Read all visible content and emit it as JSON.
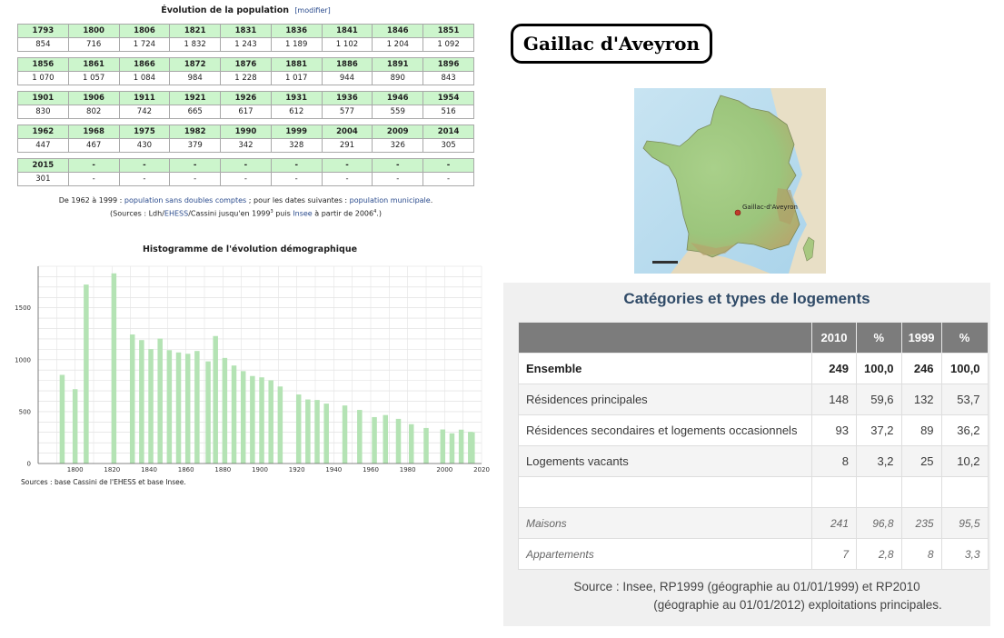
{
  "population": {
    "title": "Évolution de la population",
    "edit_link": "[modifier]",
    "rows": [
      {
        "years": [
          "1793",
          "1800",
          "1806",
          "1821",
          "1831",
          "1836",
          "1841",
          "1846",
          "1851"
        ],
        "values": [
          "854",
          "716",
          "1 724",
          "1 832",
          "1 243",
          "1 189",
          "1 102",
          "1 204",
          "1 092"
        ]
      },
      {
        "years": [
          "1856",
          "1861",
          "1866",
          "1872",
          "1876",
          "1881",
          "1886",
          "1891",
          "1896"
        ],
        "values": [
          "1 070",
          "1 057",
          "1 084",
          "984",
          "1 228",
          "1 017",
          "944",
          "890",
          "843"
        ]
      },
      {
        "years": [
          "1901",
          "1906",
          "1911",
          "1921",
          "1926",
          "1931",
          "1936",
          "1946",
          "1954"
        ],
        "values": [
          "830",
          "802",
          "742",
          "665",
          "617",
          "612",
          "577",
          "559",
          "516"
        ]
      },
      {
        "years": [
          "1962",
          "1968",
          "1975",
          "1982",
          "1990",
          "1999",
          "2004",
          "2009",
          "2014"
        ],
        "values": [
          "447",
          "467",
          "430",
          "379",
          "342",
          "328",
          "291",
          "326",
          "305"
        ]
      },
      {
        "years": [
          "2015",
          "-",
          "-",
          "-",
          "-",
          "-",
          "-",
          "-",
          "-"
        ],
        "values": [
          "301",
          "-",
          "-",
          "-",
          "-",
          "-",
          "-",
          "-",
          "-"
        ]
      }
    ],
    "note": {
      "p1": "De 1962 à 1999 : ",
      "l1": "population sans doubles comptes",
      "p2": " ; pour les dates suivantes : ",
      "l2": "population municipale",
      "p3": ".",
      "p4": "(Sources : Ldh/",
      "l3": "EHESS",
      "p5": "/Cassini jusqu'en 1999",
      "sup1": "3",
      "p6": " puis ",
      "l4": "Insee",
      "p7": " à partir de 2006",
      "sup2": "4",
      "p8": ".)"
    }
  },
  "chart_data": {
    "type": "bar",
    "title": "Histogramme de l'évolution démographique",
    "x": [
      1793,
      1800,
      1806,
      1821,
      1831,
      1836,
      1841,
      1846,
      1851,
      1856,
      1861,
      1866,
      1872,
      1876,
      1881,
      1886,
      1891,
      1896,
      1901,
      1906,
      1911,
      1921,
      1926,
      1931,
      1936,
      1946,
      1954,
      1962,
      1968,
      1975,
      1982,
      1990,
      1999,
      2004,
      2009,
      2014,
      2015
    ],
    "values": [
      854,
      716,
      1724,
      1832,
      1243,
      1189,
      1102,
      1204,
      1092,
      1070,
      1057,
      1084,
      984,
      1228,
      1017,
      944,
      890,
      843,
      830,
      802,
      742,
      665,
      617,
      612,
      577,
      559,
      516,
      447,
      467,
      430,
      379,
      342,
      328,
      291,
      326,
      305,
      301
    ],
    "xlim": [
      1780,
      2020
    ],
    "ylim": [
      0,
      1900
    ],
    "xticks": [
      1800,
      1820,
      1840,
      1860,
      1880,
      1900,
      1920,
      1940,
      1960,
      1980,
      2000,
      2020
    ],
    "yticks": [
      0,
      500,
      1000,
      1500
    ],
    "grid": true,
    "bar_color": "#b4e3b4",
    "source": "Sources : base Cassini de l'EHESS et base Insee."
  },
  "commune": {
    "name": "Gaillac d'Aveyron"
  },
  "map": {
    "marker_label": "Gaillac-d'Aveyron",
    "marker_color": "#c0392b"
  },
  "housing": {
    "title": "Catégories et types de logements",
    "headers": [
      "",
      "2010",
      "%",
      "1999",
      "%"
    ],
    "rows": [
      {
        "cells": [
          "Ensemble",
          "249",
          "100,0",
          "246",
          "100,0"
        ],
        "style": "bold"
      },
      {
        "cells": [
          "Résidences principales",
          "148",
          "59,6",
          "132",
          "53,7"
        ],
        "style": "normal"
      },
      {
        "cells": [
          "Résidences secondaires et logements occasionnels",
          "93",
          "37,2",
          "89",
          "36,2"
        ],
        "style": "normal"
      },
      {
        "cells": [
          "Logements vacants",
          "8",
          "3,2",
          "25",
          "10,2"
        ],
        "style": "normal"
      },
      {
        "cells": [
          "",
          "",
          "",
          "",
          ""
        ],
        "style": "normal"
      },
      {
        "cells": [
          "Maisons",
          "241",
          "96,8",
          "235",
          "95,5"
        ],
        "style": "ital"
      },
      {
        "cells": [
          "Appartements",
          "7",
          "2,8",
          "8",
          "3,3"
        ],
        "style": "ital"
      }
    ],
    "source_line1": "Source : Insee, RP1999 (géographie au 01/01/1999) et RP2010",
    "source_line2": "(géographie au 01/01/2012) exploitations principales."
  }
}
